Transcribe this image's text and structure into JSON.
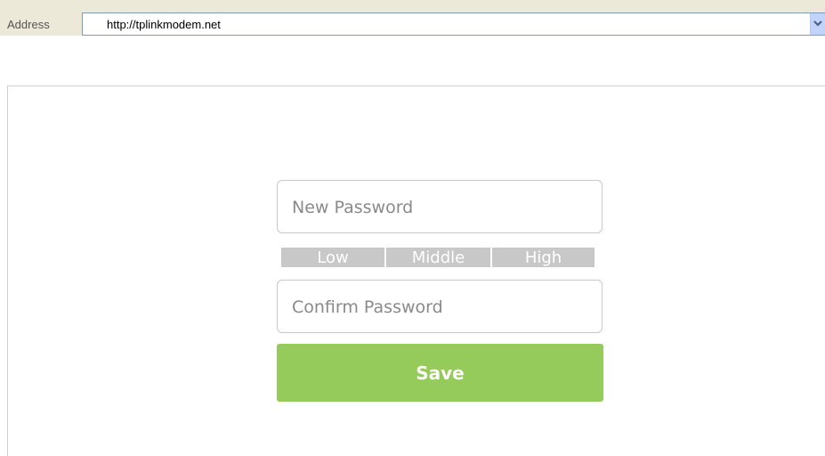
{
  "browser": {
    "address_label": "Address",
    "url": "http://tplinkmodem.net",
    "dropdown_icon": "chevron-down-icon"
  },
  "form": {
    "new_password_placeholder": "New Password",
    "confirm_password_placeholder": "Confirm Password",
    "strength": {
      "low": "Low",
      "middle": "Middle",
      "high": "High"
    },
    "save_label": "Save"
  },
  "colors": {
    "save_button": "#95cb5a",
    "strength_bar": "#c8c8c8",
    "toolbar": "#ece9d8"
  }
}
